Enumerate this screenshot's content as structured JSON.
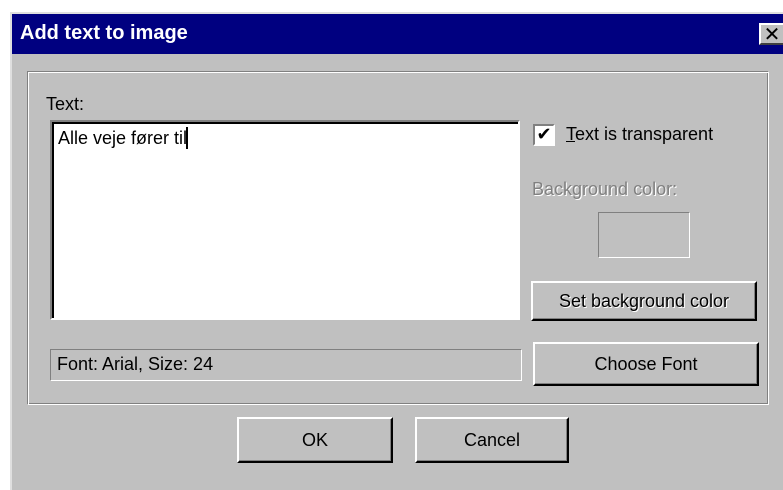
{
  "window": {
    "title": "Add text to image",
    "close_glyph": "✕"
  },
  "form": {
    "text_label": "Text:",
    "text_value": "Alle veje fører til",
    "transparent_checkbox": {
      "checked": true,
      "check_glyph": "✔",
      "label_mnemonic": "T",
      "label_rest": "ext is transparent"
    },
    "background_color_label": "Background color:",
    "set_background_color_button": "Set background color",
    "font_info": "Font: Arial, Size: 24",
    "choose_font_button": "Choose Font"
  },
  "footer": {
    "ok_button": "OK",
    "cancel_button": "Cancel"
  },
  "colors": {
    "titlebar": "#000080",
    "face": "#c0c0c0"
  },
  "icons": {
    "close": "close-icon",
    "check": "check-icon"
  }
}
